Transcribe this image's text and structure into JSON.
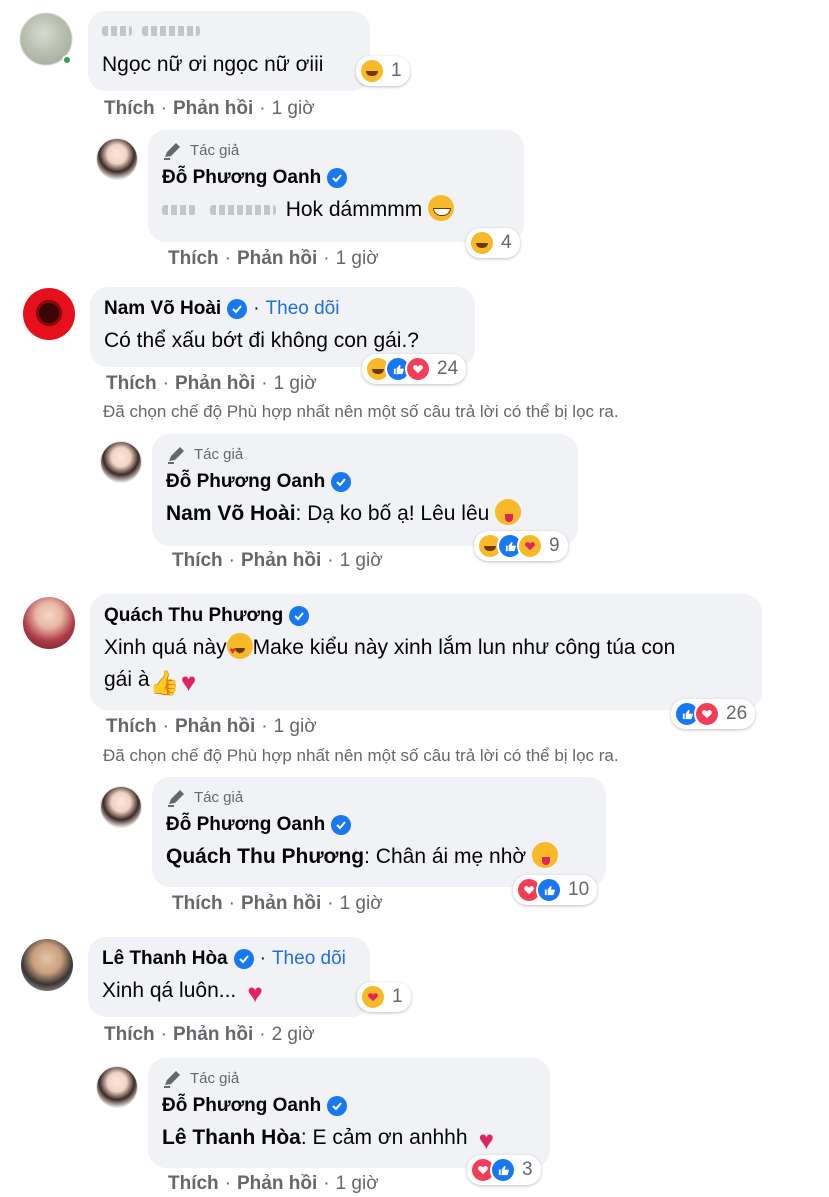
{
  "labels": {
    "like": "Thích",
    "reply": "Phản hồi",
    "dot": "·",
    "author_tag": "Tác giả",
    "follow": "Theo dõi",
    "filter_note": "Đã chọn chế độ Phù hợp nhất nên một số câu trả lời có thể bị lọc ra."
  },
  "colors": {
    "bubble_bg": "#f0f2f5",
    "link_blue": "#216fdb",
    "verified_blue": "#1877f2",
    "meta_gray": "#65676b"
  },
  "comments": [
    {
      "author": "",
      "text": "Ngọc nữ ơi ngọc nữ ơiii",
      "time": "1 giờ",
      "reaction_count": "1",
      "reactions": [
        "haha"
      ],
      "reply": {
        "author": "Đỗ Phương Oanh",
        "mention": "",
        "text": "Hok dámmmm",
        "emoji": "grinning-squint-icon",
        "time": "1 giờ",
        "reaction_count": "4",
        "reactions": [
          "haha"
        ]
      }
    },
    {
      "author": "Nam Võ Hoài",
      "text": "Có thể xấu bớt đi không con gái.?",
      "time": "1 giờ",
      "reaction_count": "24",
      "reactions": [
        "haha",
        "like",
        "love"
      ],
      "reply": {
        "author": "Đỗ Phương Oanh",
        "mention": "Nam Võ Hoài",
        "text": ": Dạ ko bố ạ! Lêu lêu",
        "emoji": "tongue-icon",
        "time": "1 giờ",
        "reaction_count": "9",
        "reactions": [
          "haha",
          "like",
          "care"
        ]
      }
    },
    {
      "author": "Quách Thu Phương",
      "text_part1": "Xinh quá này",
      "text_part2": "Make kiểu này xinh lắm lun như công túa con",
      "text_part3": "gái à",
      "time": "1 giờ",
      "reaction_count": "26",
      "reactions": [
        "like",
        "love"
      ],
      "reply": {
        "author": "Đỗ Phương Oanh",
        "mention": "Quách Thu Phương",
        "text": ": Chân ái mẹ nhờ",
        "emoji": "tongue-icon",
        "time": "1 giờ",
        "reaction_count": "10",
        "reactions": [
          "love",
          "like"
        ]
      }
    },
    {
      "author": "Lê Thanh Hòa",
      "text": "Xinh qá luôn...",
      "time": "2 giờ",
      "reaction_count": "1",
      "reactions": [
        "care"
      ],
      "reply": {
        "author": "Đỗ Phương Oanh",
        "mention": "Lê Thanh Hòa",
        "text": ": E cảm ơn anhhh",
        "emoji": "heart-icon",
        "time": "1 giờ",
        "reaction_count": "3",
        "reactions": [
          "love",
          "like"
        ]
      }
    }
  ]
}
